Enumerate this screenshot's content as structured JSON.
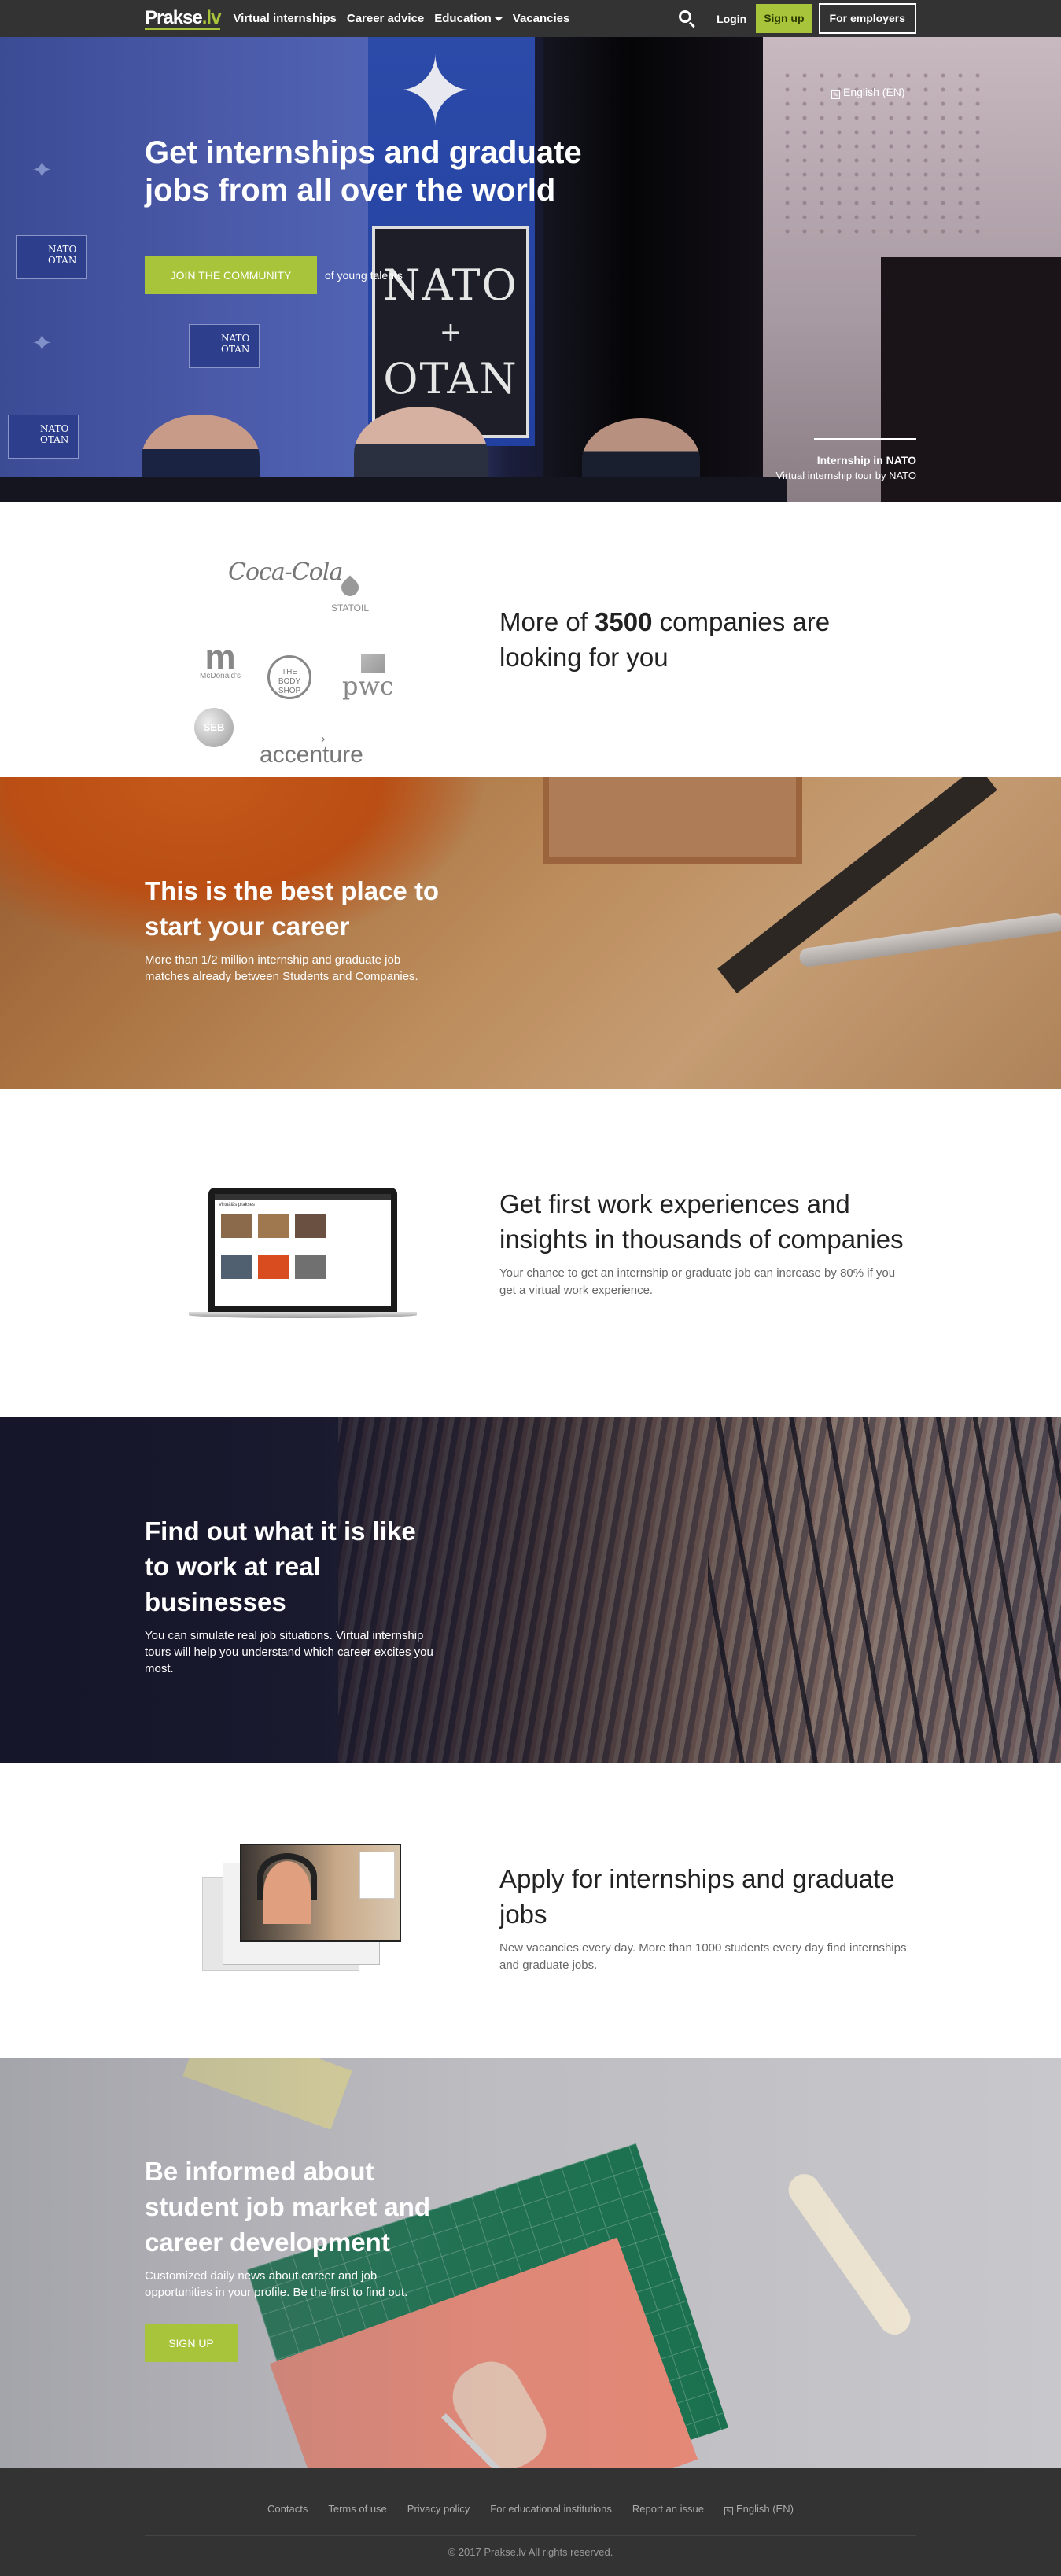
{
  "nav": {
    "logo": "Prakse",
    "logo_suffix": ".lv",
    "links": [
      "Virtual internships",
      "Career advice",
      "Education",
      "Vacancies"
    ],
    "login": "Login",
    "signup": "Sign up",
    "employers": "For employers"
  },
  "hero": {
    "language": "English (EN)",
    "title_part1": "Get ",
    "title_bold1": "internships",
    "title_part2": " and ",
    "title_bold2": "graduate jobs",
    "title_part3": " from all over the world",
    "cta_button": "JOIN THE COMMUNITY",
    "cta_suffix": "of young talents",
    "sign_line1": "NATO",
    "sign_plus": "+",
    "sign_line2": "OTAN",
    "flag_text1": "NATO",
    "flag_text2": "OTAN",
    "caption_title": "Internship in NATO",
    "caption_sub": "Virtual internship tour by NATO",
    "slides": 6,
    "active_slide": 1
  },
  "companies": {
    "logos": [
      "Coca-Cola",
      "STATOIL",
      "McDonald's",
      "THE BODY SHOP",
      "pwc",
      "SEB",
      "accenture"
    ],
    "title_part1": "More of ",
    "title_bold": "3500",
    "title_part2": " companies are looking for you"
  },
  "best_place": {
    "title": "This is the best place to start your career",
    "desc": "More than 1/2 million internship and graduate job matches already between Students and Companies."
  },
  "experience": {
    "title": "Get first work experiences and insights in thousands of companies",
    "desc": "Your chance to get an internship or graduate job can increase by 80% if you get a virtual work experience.",
    "laptop_heading": "Virtuālās prakses"
  },
  "real_business": {
    "title": "Find out what it is like to work at real businesses",
    "desc": "You can simulate real job situations. Virtual internship tours will help you understand which career excites you most."
  },
  "apply": {
    "title": "Apply for internships and graduate jobs",
    "desc": "New vacancies every day. More than 1000 students every day find internships and graduate jobs."
  },
  "informed": {
    "title": "Be informed about student job market and career development",
    "desc": "Customized daily news about career and job opportunities in your profile. Be the first to find out.",
    "button": "SIGN UP"
  },
  "footer": {
    "links": [
      "Contacts",
      "Terms of use",
      "Privacy policy",
      "For educational institutions",
      "Report an issue"
    ],
    "language": "English (EN)",
    "copyright": "© 2017 Prakse.lv All rights reserved."
  },
  "colors": {
    "accent": "#a8c43a",
    "nav_bg": "#333333",
    "footer_bg": "#333333"
  }
}
